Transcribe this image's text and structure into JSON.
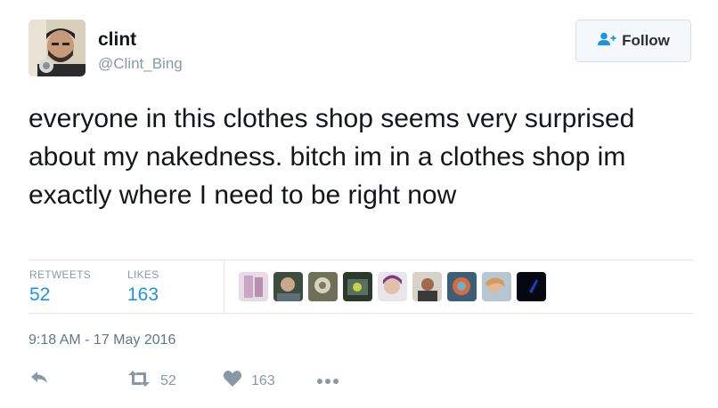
{
  "author": {
    "name": "clint",
    "handle": "@Clint_Bing"
  },
  "follow_button": {
    "label": "Follow"
  },
  "tweet": {
    "text": "everyone in this clothes shop seems very surprised about my nakedness. bitch im in a clothes shop im exactly where I need to be right now",
    "timestamp": "9:18 AM - 17 May 2016"
  },
  "stats": {
    "retweets_label": "RETWEETS",
    "retweets_value": "52",
    "likes_label": "LIKES",
    "likes_value": "163"
  },
  "actions": {
    "retweet_count": "52",
    "like_count": "163"
  },
  "icons": {
    "follow": "add-user-icon",
    "reply": "reply-icon",
    "retweet": "retweet-icon",
    "like": "heart-icon",
    "more": "more-icon"
  },
  "colors": {
    "link_blue": "#1b95e0",
    "muted_gray": "#8899a6",
    "text": "#14171a"
  }
}
